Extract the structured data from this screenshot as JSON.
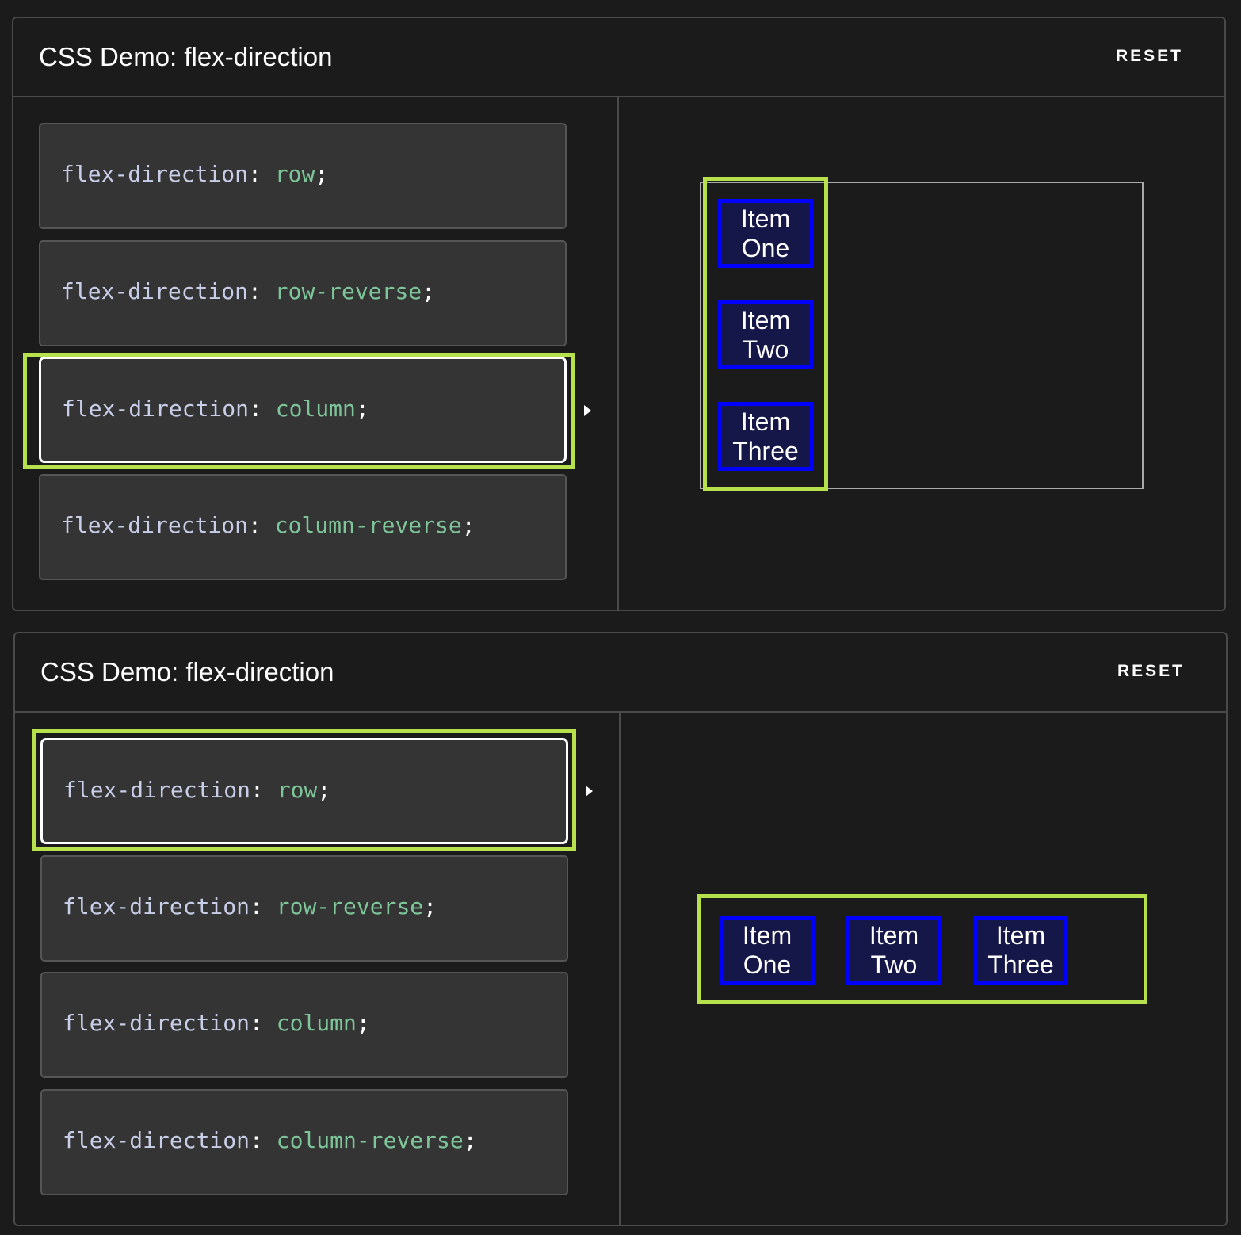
{
  "demos": [
    {
      "title": "CSS Demo: flex-direction",
      "reset_label": "RESET",
      "selected_index": 2,
      "choices": [
        {
          "property": "flex-direction",
          "colon": ":",
          "value": "row",
          "semicolon": ";"
        },
        {
          "property": "flex-direction",
          "colon": ":",
          "value": "row-reverse",
          "semicolon": ";"
        },
        {
          "property": "flex-direction",
          "colon": ":",
          "value": "column",
          "semicolon": ";"
        },
        {
          "property": "flex-direction",
          "colon": ":",
          "value": "column-reverse",
          "semicolon": ";"
        }
      ],
      "items": [
        {
          "line1": "Item",
          "line2": "One"
        },
        {
          "line1": "Item",
          "line2": "Two"
        },
        {
          "line1": "Item",
          "line2": "Three"
        }
      ]
    },
    {
      "title": "CSS Demo: flex-direction",
      "reset_label": "RESET",
      "selected_index": 0,
      "choices": [
        {
          "property": "flex-direction",
          "colon": ":",
          "value": "row",
          "semicolon": ";"
        },
        {
          "property": "flex-direction",
          "colon": ":",
          "value": "row-reverse",
          "semicolon": ";"
        },
        {
          "property": "flex-direction",
          "colon": ":",
          "value": "column",
          "semicolon": ";"
        },
        {
          "property": "flex-direction",
          "colon": ":",
          "value": "column-reverse",
          "semicolon": ";"
        }
      ],
      "items": [
        {
          "line1": "Item",
          "line2": "One"
        },
        {
          "line1": "Item",
          "line2": "Two"
        },
        {
          "line1": "Item",
          "line2": "Three"
        }
      ]
    }
  ],
  "colors": {
    "highlight": "#b6e04c",
    "item_border": "#0000ff",
    "item_bg": "#151748",
    "value_text": "#7ec69a",
    "property_text": "#c8cde8"
  }
}
